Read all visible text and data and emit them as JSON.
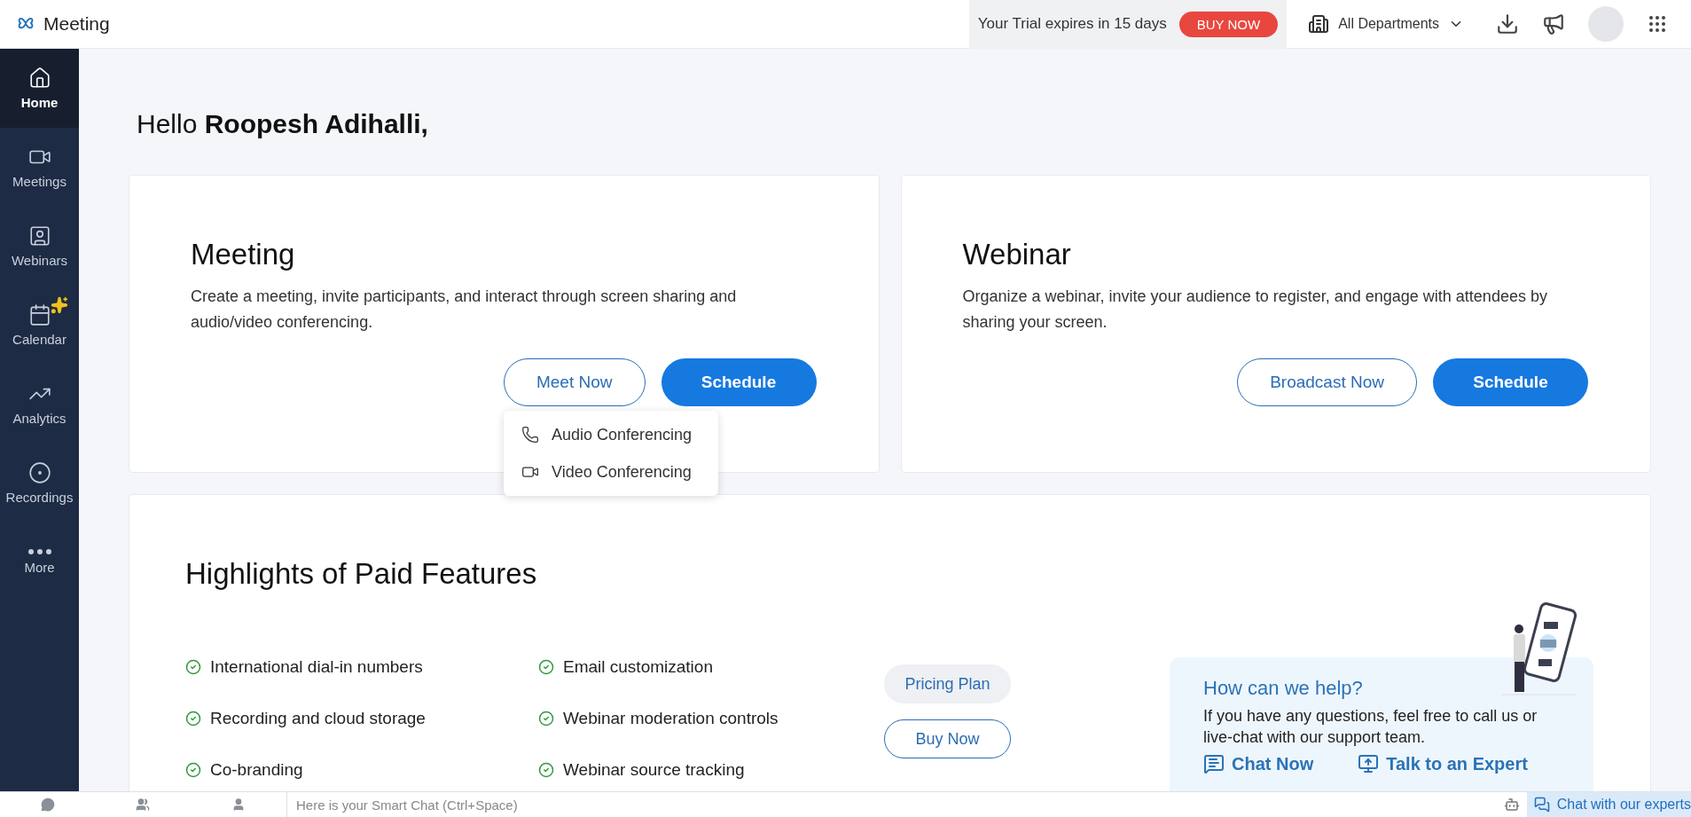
{
  "app": {
    "name": "Meeting"
  },
  "topbar": {
    "trial": "Your Trial expires in 15 days",
    "buy": "BUY NOW",
    "department": "All Departments"
  },
  "sidebar": {
    "items": [
      {
        "kind": "home",
        "label": "Home",
        "selected": true
      },
      {
        "kind": "meetings",
        "label": "Meetings",
        "selected": false
      },
      {
        "kind": "webinars",
        "label": "Webinars",
        "selected": false
      },
      {
        "kind": "calendar",
        "label": "Calendar",
        "selected": false
      },
      {
        "kind": "analytics",
        "label": "Analytics",
        "selected": false
      },
      {
        "kind": "recordings",
        "label": "Recordings",
        "selected": false
      },
      {
        "kind": "more",
        "label": "More",
        "selected": false
      }
    ]
  },
  "greeting": "Hello **Roopesh Adihalli,**",
  "cards": [
    {
      "title": "Meeting",
      "text": "Create a meeting, invite participants, and interact through screen sharing and audio/video conferencing.",
      "secondary": "Meet Now",
      "primary": "Schedule",
      "menu": [
        {
          "kind": "audio",
          "label": "Audio Conferencing"
        },
        {
          "kind": "video",
          "label": "Video Conferencing"
        }
      ]
    },
    {
      "title": "Webinar",
      "text": "Organize a webinar, invite your audience to register, and engage with attendees by sharing your screen.",
      "secondary": "Broadcast Now",
      "primary": "Schedule"
    }
  ],
  "highlights": {
    "title": "Highlights of Paid Features",
    "features": [
      "International dial-in numbers",
      "Email customization",
      "Recording and cloud storage",
      "Webinar moderation controls",
      "Co-branding",
      "Webinar source tracking"
    ],
    "pricing": "Pricing Plan",
    "buy": "Buy Now",
    "help": {
      "title": "How can we help?",
      "text": "If you have any questions, feel free to call us or live-chat with our support team.",
      "chat": "Chat Now",
      "expert": "Talk to an Expert"
    }
  },
  "bottombar": {
    "placeholder": "Here is your Smart Chat (Ctrl+Space)",
    "experts": "Chat with our experts"
  }
}
